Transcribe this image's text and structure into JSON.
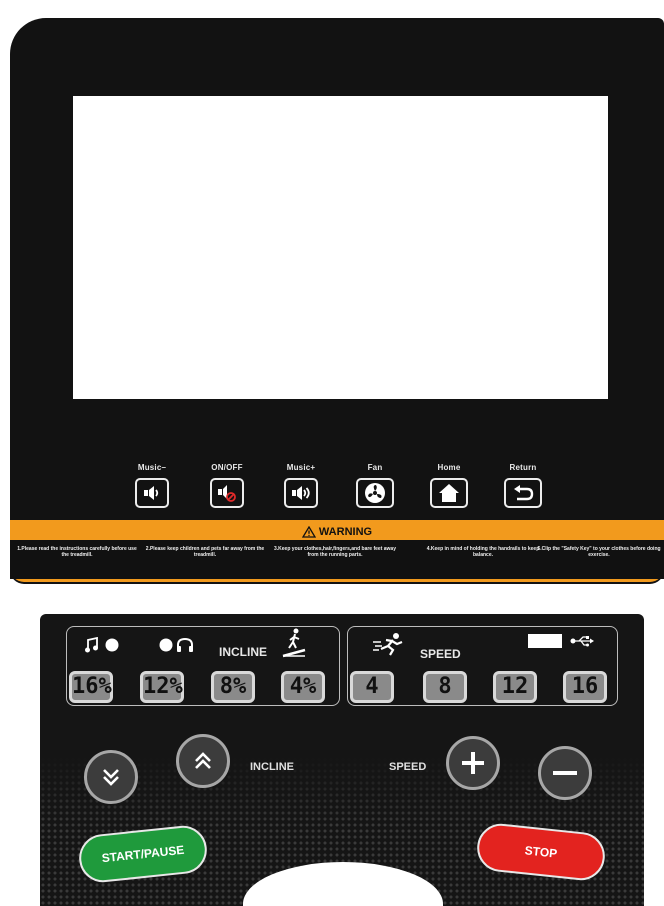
{
  "quick_keys": [
    {
      "label": "Music–",
      "icon": "volume-down-icon"
    },
    {
      "label": "ON/OFF",
      "icon": "mute-icon"
    },
    {
      "label": "Music+",
      "icon": "volume-up-icon"
    },
    {
      "label": "Fan",
      "icon": "fan-icon"
    },
    {
      "label": "Home",
      "icon": "home-icon"
    },
    {
      "label": "Return",
      "icon": "return-icon"
    }
  ],
  "warning": {
    "title": "WARNING",
    "notices": [
      "1.Please read the instructions carefully before use the treadmill.",
      "2.Please keep children and pets far away from the treadmill.",
      "3.Keep your clothes,hair,fingers,and bare feet away from the running parts.",
      "4.Keep in mind of holding the handrails to keep balance.",
      "5.Clip the \"Safety Key\" to your clothes before doing exercise."
    ]
  },
  "incline_panel": {
    "label": "INCLINE",
    "presets": [
      "16%",
      "12%",
      "8%",
      "4%"
    ]
  },
  "speed_panel": {
    "label": "SPEED",
    "presets": [
      "4",
      "8",
      "12",
      "16"
    ]
  },
  "controls": {
    "incline_label": "INCLINE",
    "speed_label": "SPEED",
    "start_label": "START/PAUSE",
    "stop_label": "STOP"
  },
  "colors": {
    "warning_orange": "#f29a1d",
    "start_green": "#1f9a3c",
    "stop_red": "#e3231f"
  }
}
